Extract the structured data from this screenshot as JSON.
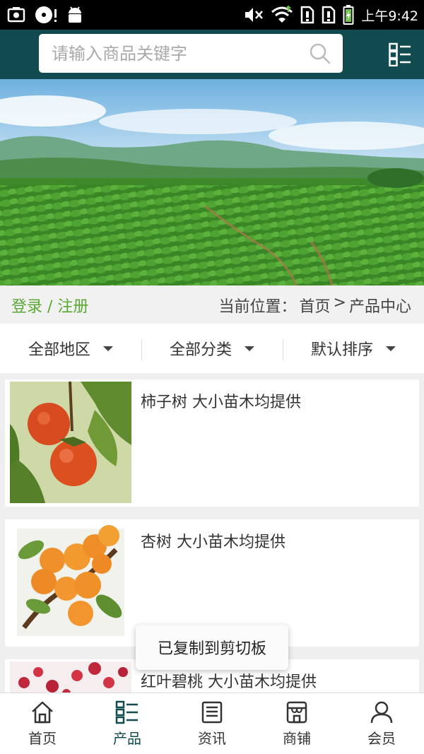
{
  "status_bar": {
    "time": "上午9:42",
    "left_icons": [
      "screenshot-icon",
      "disc-icon",
      "android-icon"
    ],
    "right_icons": [
      "mute-icon",
      "wifi-icon",
      "sim1-icon",
      "sim2-icon",
      "battery-icon"
    ]
  },
  "header": {
    "search_placeholder": "请输入商品关键字",
    "menu_icon": "list-menu-icon",
    "bar_color": "#114b4f"
  },
  "breadcrumb_bar": {
    "login_label": "登录 / 注册",
    "prefix": "当前位置：",
    "items": [
      "首页",
      ">",
      "产品中心"
    ],
    "login_color": "#5aa832"
  },
  "filters": [
    {
      "label": "全部地区"
    },
    {
      "label": "全部分类"
    },
    {
      "label": "默认排序"
    }
  ],
  "products": [
    {
      "title": "柿子树 大小苗木均提供",
      "image": "persimmon-photo"
    },
    {
      "title": "杏树 大小苗木均提供",
      "image": "apricot-photo"
    },
    {
      "title": "红叶碧桃 大小苗木均提供",
      "image": "peach-blossom-photo"
    }
  ],
  "toast": {
    "text": "已复制到剪切板"
  },
  "tabbar": {
    "tabs": [
      {
        "label": "首页",
        "icon": "home-icon"
      },
      {
        "label": "产品",
        "icon": "product-list-icon"
      },
      {
        "label": "资讯",
        "icon": "news-icon"
      },
      {
        "label": "商铺",
        "icon": "shop-icon"
      },
      {
        "label": "会员",
        "icon": "member-icon"
      }
    ],
    "active_index": 1
  }
}
